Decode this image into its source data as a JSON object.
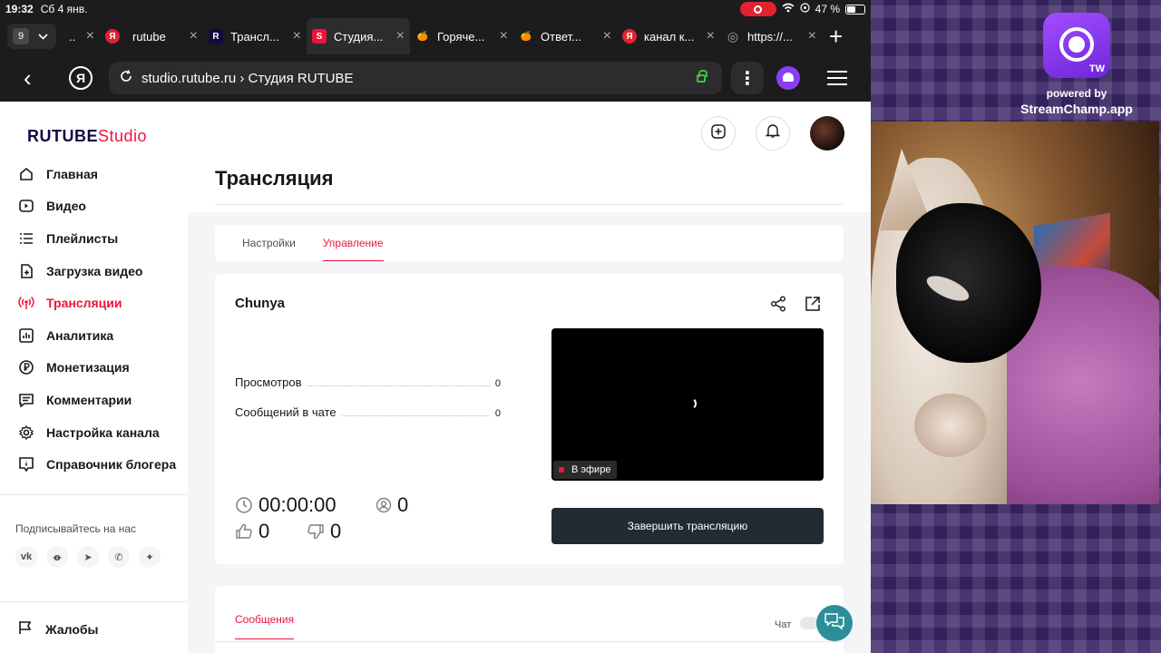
{
  "status_bar": {
    "time": "19:32",
    "date": "Сб 4 янв.",
    "battery": "47 %"
  },
  "tab_bar": {
    "count": "9",
    "first_tab_title": "..",
    "tabs": [
      {
        "title": "rutube",
        "favicon": "Я",
        "color": "#e0232e"
      },
      {
        "title": "Трансл...",
        "favicon": "R",
        "color": "#100943"
      },
      {
        "title": "Студия...",
        "favicon": "S",
        "color": "#ed143b",
        "active": true
      },
      {
        "title": "Горяче...",
        "favicon": "🍊",
        "color": "#1c1c1e"
      },
      {
        "title": "Ответ...",
        "favicon": "🍊",
        "color": "#1c1c1e"
      },
      {
        "title": "канал к...",
        "favicon": "Я",
        "color": "#e0232e"
      },
      {
        "title": "https://...",
        "favicon": "◎",
        "color": "#1c1c1e"
      }
    ],
    "new_tab": "+"
  },
  "address_bar": {
    "back": "‹",
    "yandex": "Я",
    "url": "studio.rutube.ru › Студия RUTUBE",
    "kebab": "⋮"
  },
  "logo": {
    "brand": "RUTUBE",
    "suffix": "Studio"
  },
  "sidebar": {
    "items": [
      {
        "label": "Главная",
        "icon": "home-icon"
      },
      {
        "label": "Видео",
        "icon": "video-icon"
      },
      {
        "label": "Плейлисты",
        "icon": "playlist-icon"
      },
      {
        "label": "Загрузка видео",
        "icon": "upload-icon"
      },
      {
        "label": "Трансляции",
        "icon": "broadcast-icon",
        "active": true
      },
      {
        "label": "Аналитика",
        "icon": "analytics-icon"
      },
      {
        "label": "Монетизация",
        "icon": "ruble-icon"
      },
      {
        "label": "Комментарии",
        "icon": "comments-icon"
      },
      {
        "label": "Настройка канала",
        "icon": "gear-icon"
      },
      {
        "label": "Справочник блогера",
        "icon": "info-icon"
      }
    ],
    "follow_label": "Подписывайтесь на нас",
    "socials": [
      "vk",
      "ok",
      "telegram",
      "viber",
      "zen"
    ],
    "social_glyphs": [
      "vk",
      "ꝋ",
      "➤",
      "✆",
      "✦"
    ],
    "complaints": "Жалобы"
  },
  "main": {
    "title": "Трансляция",
    "tabs": [
      {
        "label": "Настройки"
      },
      {
        "label": "Управление",
        "active": true
      }
    ],
    "stream": {
      "name": "Chunya",
      "stats": [
        {
          "label": "Просмотров",
          "value": "0"
        },
        {
          "label": "Сообщений в чате",
          "value": "0"
        }
      ],
      "live_badge": "В эфире",
      "duration": "00:00:00",
      "viewers": "0",
      "likes": "0",
      "dislikes": "0",
      "finish_button": "Завершить трансляцию"
    },
    "messages": {
      "tab": "Сообщения",
      "chat_label": "Чат"
    }
  },
  "overlay": {
    "badge": "TW",
    "powered_by": "powered by",
    "brand": "StreamChamp.app"
  },
  "colors": {
    "accent": "#ed143b",
    "dark_button": "#222a33",
    "fab": "#2b8f99",
    "overlay_purple": "#3a2566"
  }
}
